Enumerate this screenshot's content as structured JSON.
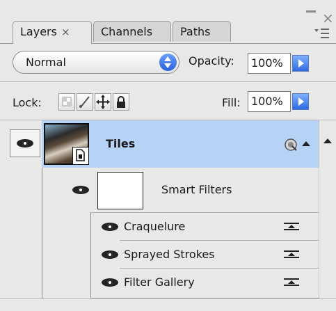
{
  "window": {
    "close_icon": "close-icon",
    "minimize_icon": "minimize-icon",
    "panel_menu_icon": "panel-menu-icon"
  },
  "tabs": [
    {
      "label": "Layers",
      "close": "×",
      "active": true
    },
    {
      "label": "Channels",
      "active": false
    },
    {
      "label": "Paths",
      "active": false
    }
  ],
  "blend_mode": {
    "value": "Normal"
  },
  "opacity": {
    "label": "Opacity:",
    "value": "100%"
  },
  "lock": {
    "label": "Lock:",
    "buttons": [
      "lock-transparent-pixels-icon",
      "lock-image-pixels-icon",
      "lock-position-icon",
      "lock-all-icon"
    ]
  },
  "fill": {
    "label": "Fill:",
    "value": "100%"
  },
  "layers": {
    "main": {
      "name": "Tiles",
      "visible": true,
      "selected": true,
      "smart_object_icon": "smart-object-icon"
    },
    "smart_filters": {
      "label": "Smart Filters",
      "visible": true
    },
    "filters": [
      {
        "name": "Craquelure",
        "visible": true
      },
      {
        "name": "Sprayed Strokes",
        "visible": true
      },
      {
        "name": "Filter Gallery",
        "visible": true
      }
    ]
  },
  "colors": {
    "selection": "#b6d2f5",
    "panel": "#e8e8e8",
    "accent_blue": "#2e6be0"
  }
}
